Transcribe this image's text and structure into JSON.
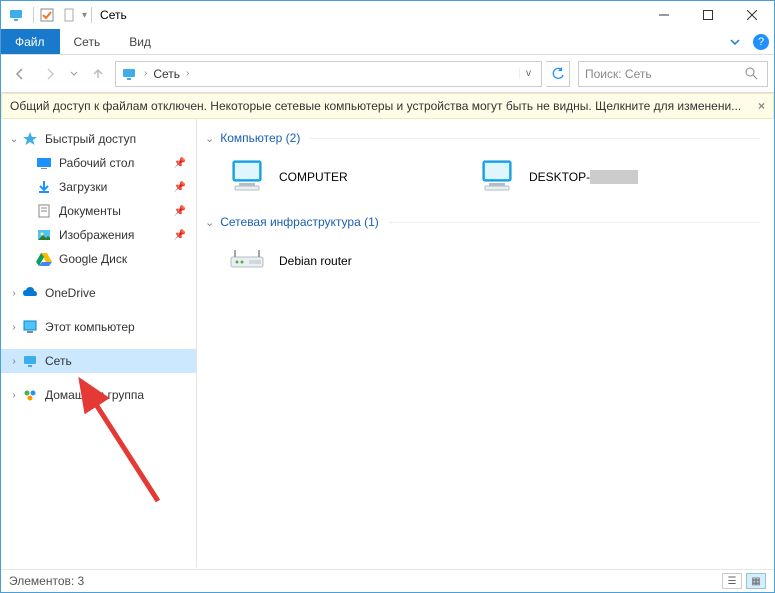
{
  "title": "Сеть",
  "menu": {
    "file": "Файл",
    "network": "Сеть",
    "view": "Вид"
  },
  "address": {
    "crumb": "Сеть"
  },
  "search": {
    "placeholder": "Поиск: Сеть"
  },
  "infobar": "Общий доступ к файлам отключен. Некоторые сетевые компьютеры и устройства могут быть не видны. Щелкните для изменени...",
  "sidebar": {
    "quick": {
      "label": "Быстрый доступ",
      "items": [
        {
          "label": "Рабочий стол"
        },
        {
          "label": "Загрузки"
        },
        {
          "label": "Документы"
        },
        {
          "label": "Изображения"
        },
        {
          "label": "Google Диск"
        }
      ]
    },
    "onedrive": "OneDrive",
    "thispc": "Этот компьютер",
    "network": "Сеть",
    "homegroup": "Домашняя группа"
  },
  "groups": [
    {
      "title": "Компьютер (2)",
      "items": [
        {
          "label": "COMPUTER"
        },
        {
          "label": "DESKTOP-"
        }
      ]
    },
    {
      "title": "Сетевая инфраструктура (1)",
      "items": [
        {
          "label": "Debian router"
        }
      ]
    }
  ],
  "status": "Элементов: 3"
}
